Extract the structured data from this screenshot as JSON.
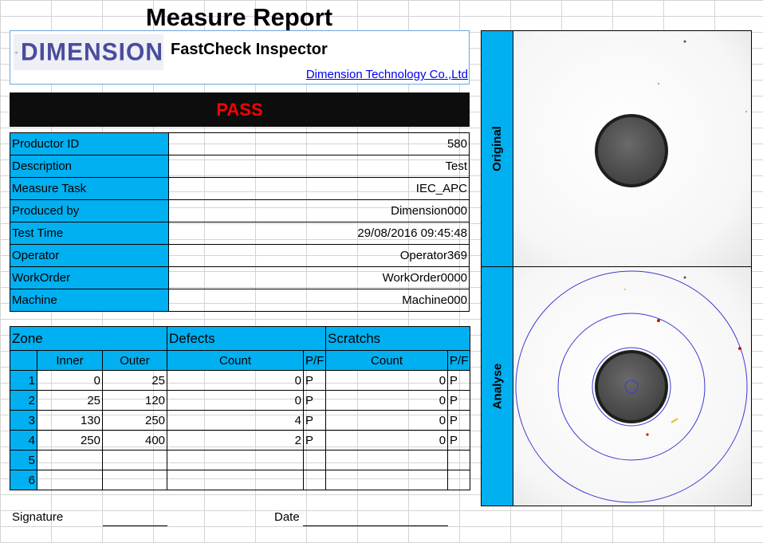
{
  "report": {
    "title": "Measure Report",
    "logo_text": "DIMENSION",
    "app_name": "FastCheck Inspector",
    "company": "Dimension Technology Co.,Ltd",
    "result": "PASS"
  },
  "info": [
    {
      "label": "Productor ID",
      "value": "580"
    },
    {
      "label": "Description",
      "value": "Test"
    },
    {
      "label": "Measure Task",
      "value": "IEC_APC"
    },
    {
      "label": "Produced by",
      "value": "Dimension000"
    },
    {
      "label": "Test Time",
      "value": "29/08/2016 09:45:48"
    },
    {
      "label": "Operator",
      "value": "Operator369"
    },
    {
      "label": "WorkOrder",
      "value": "WorkOrder0000"
    },
    {
      "label": "Machine",
      "value": "Machine000"
    }
  ],
  "zones": {
    "group_headers": {
      "zone": "Zone",
      "defects": "Defects",
      "scratchs": "Scratchs"
    },
    "columns": {
      "inner": "Inner",
      "outer": "Outer",
      "count": "Count",
      "pf": "P/F"
    },
    "rows": [
      {
        "idx": "1",
        "inner": "0",
        "outer": "25",
        "def_count": "0",
        "def_pf": "P",
        "scr_count": "0",
        "scr_pf": "P"
      },
      {
        "idx": "2",
        "inner": "25",
        "outer": "120",
        "def_count": "0",
        "def_pf": "P",
        "scr_count": "0",
        "scr_pf": "P"
      },
      {
        "idx": "3",
        "inner": "130",
        "outer": "250",
        "def_count": "4",
        "def_pf": "P",
        "scr_count": "0",
        "scr_pf": "P"
      },
      {
        "idx": "4",
        "inner": "250",
        "outer": "400",
        "def_count": "2",
        "def_pf": "P",
        "scr_count": "0",
        "scr_pf": "P"
      },
      {
        "idx": "5",
        "inner": "",
        "outer": "",
        "def_count": "",
        "def_pf": "",
        "scr_count": "",
        "scr_pf": ""
      },
      {
        "idx": "6",
        "inner": "",
        "outer": "",
        "def_count": "",
        "def_pf": "",
        "scr_count": "",
        "scr_pf": ""
      }
    ]
  },
  "signature": {
    "signature_label": "Signature",
    "date_label": "Date"
  },
  "images": {
    "original_label": "Original",
    "analyse_label": "Analyse"
  },
  "colors": {
    "accent": "#00b0f0",
    "pass": "#ff0000",
    "status_bg": "#0d0d0d",
    "logo": "#4a4d9c"
  }
}
